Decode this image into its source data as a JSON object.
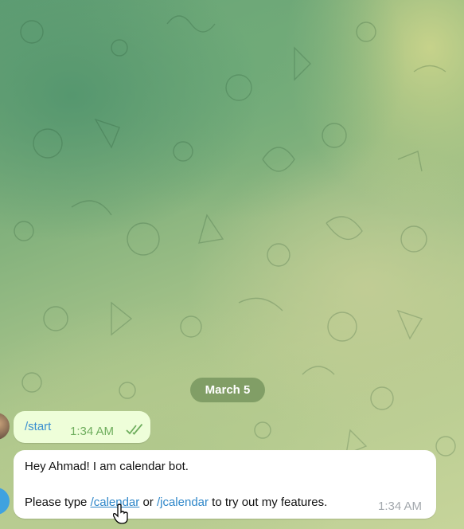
{
  "chat": {
    "date_label": "March 5",
    "messages": [
      {
        "direction": "outgoing",
        "text": "/start",
        "time": "1:34 AM",
        "status_icon": "double-check-icon"
      },
      {
        "direction": "incoming",
        "line1": "Hey Ahmad! I am calendar bot.",
        "line2_prefix": "Please type ",
        "link1": "/calendar",
        "middle": " or ",
        "link2": "/jcalendar",
        "suffix": " to try out my features.",
        "time": "1:34 AM"
      }
    ]
  },
  "colors": {
    "outgoing_bubble": "#eefed9",
    "incoming_bubble": "#ffffff",
    "link": "#2f87c9",
    "date_pill": "#78965f"
  },
  "icons": {
    "cursor": "hand-pointer-icon",
    "read_status": "double-check-icon"
  }
}
